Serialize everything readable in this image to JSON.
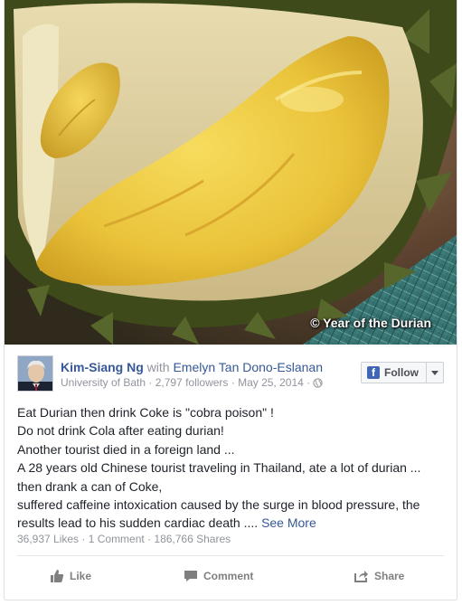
{
  "photo": {
    "watermark": "© Year of the Durian",
    "icon": "durian-photo"
  },
  "post": {
    "author": "Kim-Siang Ng",
    "with_label": "with",
    "tagged": "Emelyn Tan Dono-Eslanan",
    "meta": "University of Bath · 2,797 followers · May 25, 2014 ·",
    "privacy_icon": "globe-icon",
    "follow_label": "Follow",
    "lines": [
      "Eat Durian then drink Coke is \"cobra poison\" !",
      "Do not drink Cola after eating durian!",
      "Another tourist died in a foreign land ...",
      "A 28 years old Chinese tourist traveling in Thailand, ate a lot of durian ... then drank a can of Coke,",
      "suffered caffeine intoxication caused by the surge in blood pressure, the results lead to his sudden cardiac death ...."
    ],
    "see_more": "See More",
    "stats": "36,937 Likes · 1 Comment · 186,766 Shares"
  },
  "actions": {
    "like": "Like",
    "comment": "Comment",
    "share": "Share"
  },
  "colors": {
    "link": "#365899",
    "muted": "#90949c",
    "action": "#7f7f7f"
  }
}
